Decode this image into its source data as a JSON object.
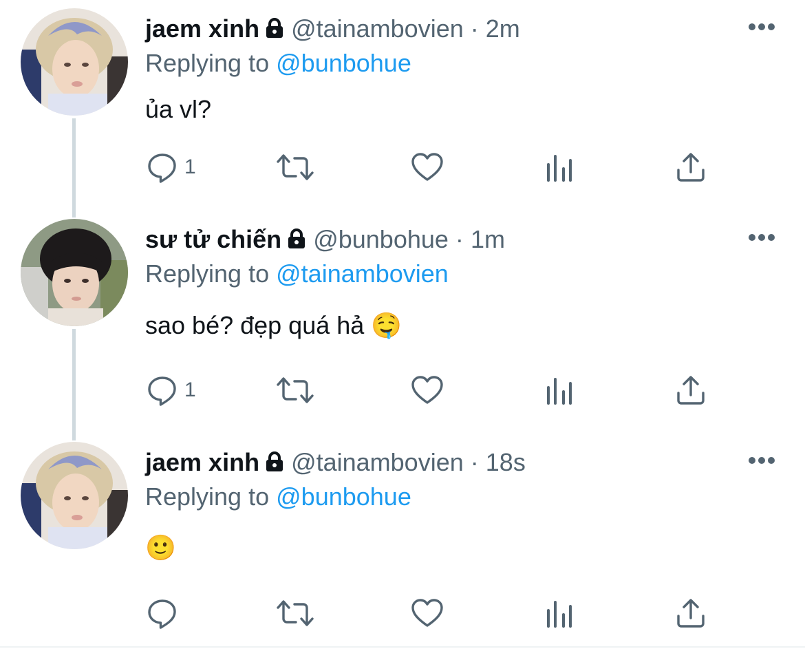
{
  "tweets": [
    {
      "display_name": "jaem xinh",
      "handle": "@tainambovien",
      "separator": "·",
      "time": "2m",
      "replying_prefix": "Replying to",
      "replying_handle": "@bunbohue",
      "text": "ủa vl?",
      "reply_count": "1",
      "protected": true
    },
    {
      "display_name": "sư tử chiến",
      "handle": "@bunbohue",
      "separator": "·",
      "time": "1m",
      "replying_prefix": "Replying to",
      "replying_handle": "@tainambovien",
      "text": "sao bé? đẹp quá hả 🤤",
      "reply_count": "1",
      "protected": true
    },
    {
      "display_name": "jaem xinh",
      "handle": "@tainambovien",
      "separator": "·",
      "time": "18s",
      "replying_prefix": "Replying to",
      "replying_handle": "@bunbohue",
      "text": "🙂",
      "reply_count": "",
      "protected": true
    }
  ],
  "icons": {
    "more": "more-horizontal-icon",
    "reply": "reply-bubble-icon",
    "retweet": "retweet-icon",
    "like": "heart-icon",
    "views": "analytics-bars-icon",
    "share": "share-upload-icon",
    "lock": "lock-icon"
  },
  "colors": {
    "text_primary": "#0f1419",
    "text_secondary": "#536471",
    "link": "#1d9bf0",
    "thread_line": "#cfd9de"
  }
}
